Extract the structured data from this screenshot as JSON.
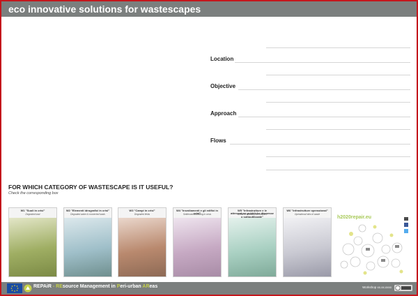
{
  "header": {
    "title": "eco innovative solutions for wastescapes"
  },
  "fields": [
    {
      "label": "Location"
    },
    {
      "label": "Objective"
    },
    {
      "label": "Approach"
    },
    {
      "label": "Flows"
    }
  ],
  "question": {
    "title": "FOR WHICH CATEGORY OF WASTESCAPE IS IT USEFUL?",
    "subtitle": "Check the corresponding box"
  },
  "cards": [
    {
      "title": "W1 \"Suoli in crisi\"",
      "subtitle": "Degraded land",
      "colors": [
        "#e3e6c8",
        "#9fae63",
        "#7b8a45"
      ]
    },
    {
      "title": "W2 \"Elementi idrografici in crisi\"",
      "subtitle": "Degraded water & connected lands",
      "colors": [
        "#dce8ec",
        "#9fbfc9",
        "#6f8f8e"
      ]
    },
    {
      "title": "W3 \"Campi in crisi\"",
      "subtitle": "Degraded fields",
      "colors": [
        "#ead7cc",
        "#b9896e",
        "#8d6a55"
      ]
    },
    {
      "title": "W4 \"Insediamenti e gli edifici in crisi\"",
      "subtitle": "Settlements/building in crisis",
      "colors": [
        "#eee4ee",
        "#c6a9c3",
        "#a88ca6"
      ]
    },
    {
      "title": "W5 \"Infrastrutture e le attrezzature pubbliche dismesse o sottoutilizzate\"",
      "subtitle": "Areas of infrastructure/utilities",
      "colors": [
        "#e4f1ec",
        "#a9d0c2",
        "#7faa99"
      ]
    },
    {
      "title": "W6 \"Infrastrutture operazional\"",
      "subtitle": "Operational infra of waste",
      "colors": [
        "#f1f1f4",
        "#c9c9d2",
        "#9a9aa8"
      ]
    }
  ],
  "repair": {
    "url": "h2020repair.eu",
    "social_icons": [
      "envelope-icon",
      "facebook-icon",
      "twitter-icon"
    ]
  },
  "footer": {
    "brand_parts": [
      {
        "text": "REPAiR",
        "highlight": false
      },
      {
        "text": " - ",
        "highlight": true
      },
      {
        "text": "RE",
        "highlight": true
      },
      {
        "text": "source Management in ",
        "highlight": false
      },
      {
        "text": "P",
        "highlight": true
      },
      {
        "text": "eri-urban ",
        "highlight": false
      },
      {
        "text": "AR",
        "highlight": true
      },
      {
        "text": "eas",
        "highlight": false
      }
    ],
    "workshop": "Workshop xx.xx.xxxx"
  },
  "colors": {
    "accent_red": "#c4161c",
    "bar_grey": "#7b7f7e",
    "brand_green": "#c6d14a",
    "url_green": "#a7c957"
  }
}
